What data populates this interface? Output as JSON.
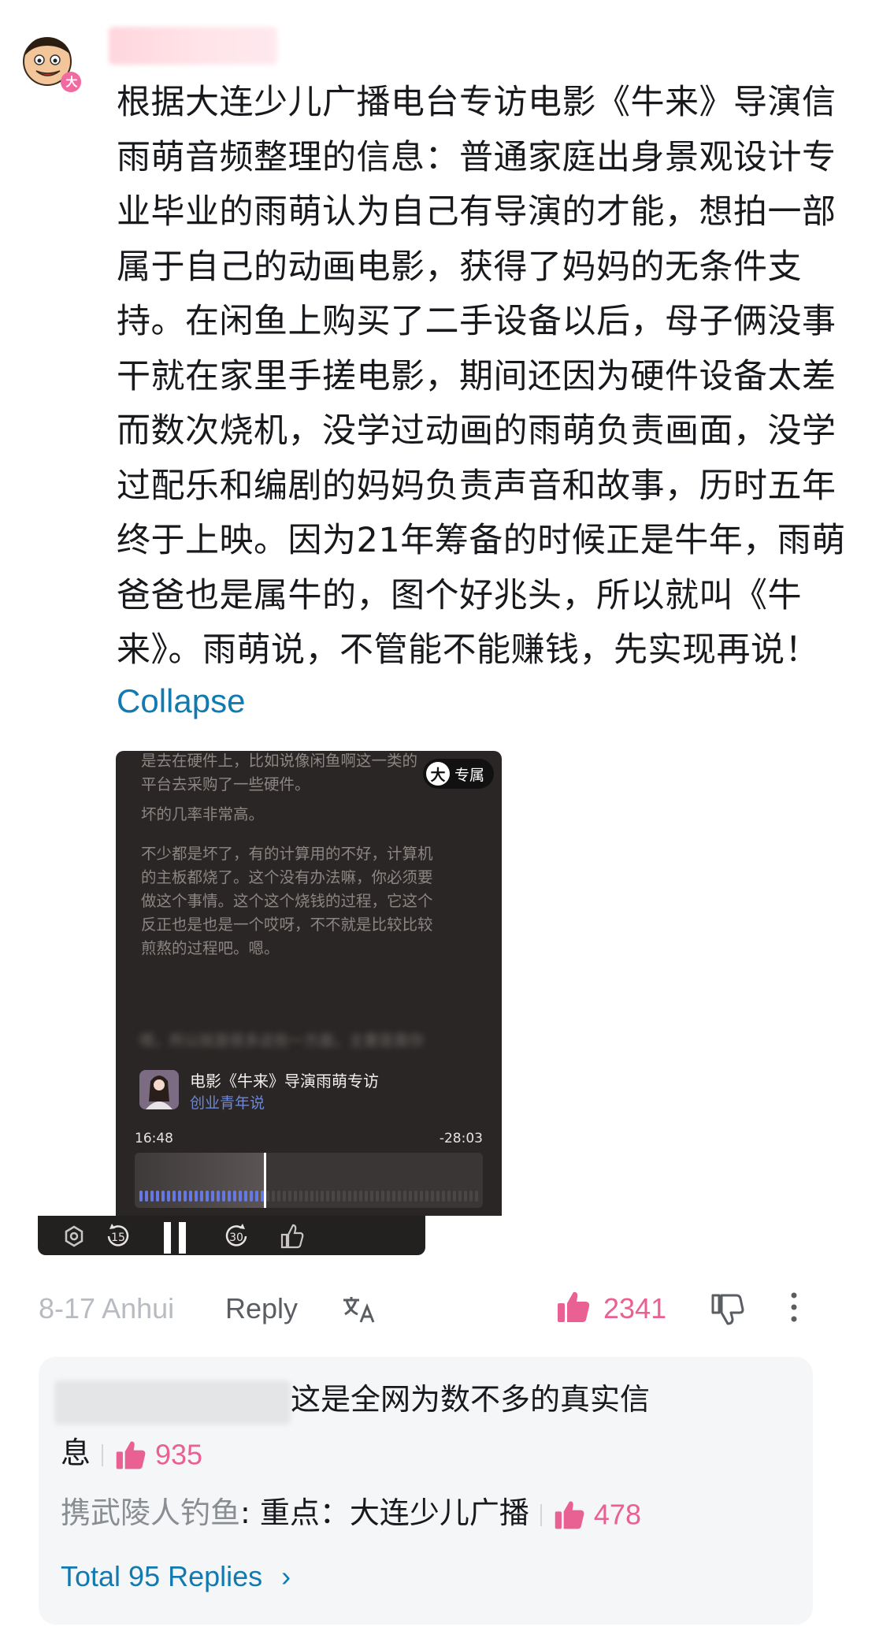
{
  "comment": {
    "text_lines": [
      "根据大连少儿广播电台专访电影《牛来》导演信",
      "雨萌音频整理的信息：普通家庭出身景观设计专",
      "业毕业的雨萌认为自己有导演的才能，想拍一部",
      "属于自己的动画电影，获得了妈妈的无条件支",
      "持。在闲鱼上购买了二手设备以后，母子俩没事",
      "干就在家里手搓电影，期间还因为硬件设备太差",
      "而数次烧机，没学过动画的雨萌负责画面，没学",
      "过配乐和编剧的妈妈负责声音和故事，历时五年",
      "终于上映。因为21年筹备的时候正是牛年，雨萌",
      "爸爸也是属牛的，图个好兆头，所以就叫《牛",
      "来》。雨萌说，不管能不能赚钱，先实现再说！"
    ],
    "collapse_label": "Collapse",
    "avatar_badge": "大"
  },
  "video": {
    "transcript_top": "是去在硬件上，比如说像闲鱼啊这一类的\n平台去采购了一些硬件。",
    "transcript_mid": "坏的几率非常高。",
    "transcript_body": "不少都是坏了，有的计算用的不好，计算机\n的主板都烧了。这个没有办法嘛，你必须要\n做这个事情。这个这个烧钱的过程，它这个\n反正也是也是一个哎呀，不不就是比较比较\n煎熬的过程吧。嗯。",
    "transcript_blurred": "嗯，所以就是很多这些一方面，主要是靠你",
    "badge_icon": "大",
    "badge_label": "专属",
    "episode_title": "电影《牛来》导演雨萌专访",
    "channel": "创业青年说",
    "time_elapsed": "16:48",
    "time_remaining": "-28:03",
    "progress": 0.37,
    "controls": [
      "settings-icon",
      "rewind-15-icon",
      "pause-icon",
      "forward-30-icon",
      "thumbs-up-icon"
    ]
  },
  "meta": {
    "date_location": "8-17 Anhui",
    "reply_label": "Reply",
    "like_count": "2341"
  },
  "replies": {
    "items": [
      {
        "author_hidden": true,
        "text_1": "这是全网为数不多的真实信",
        "text_2": "息",
        "likes": "935"
      },
      {
        "author": "携武陵人钓鱼",
        "text": ": 重点：大连少儿广播",
        "likes": "478"
      }
    ],
    "total_label": "Total 95 Replies"
  },
  "colors": {
    "accent_blue": "#127ab0",
    "like_pink": "#e96092",
    "video_bg": "#2a2625",
    "progress_blue": "#6778e0"
  }
}
